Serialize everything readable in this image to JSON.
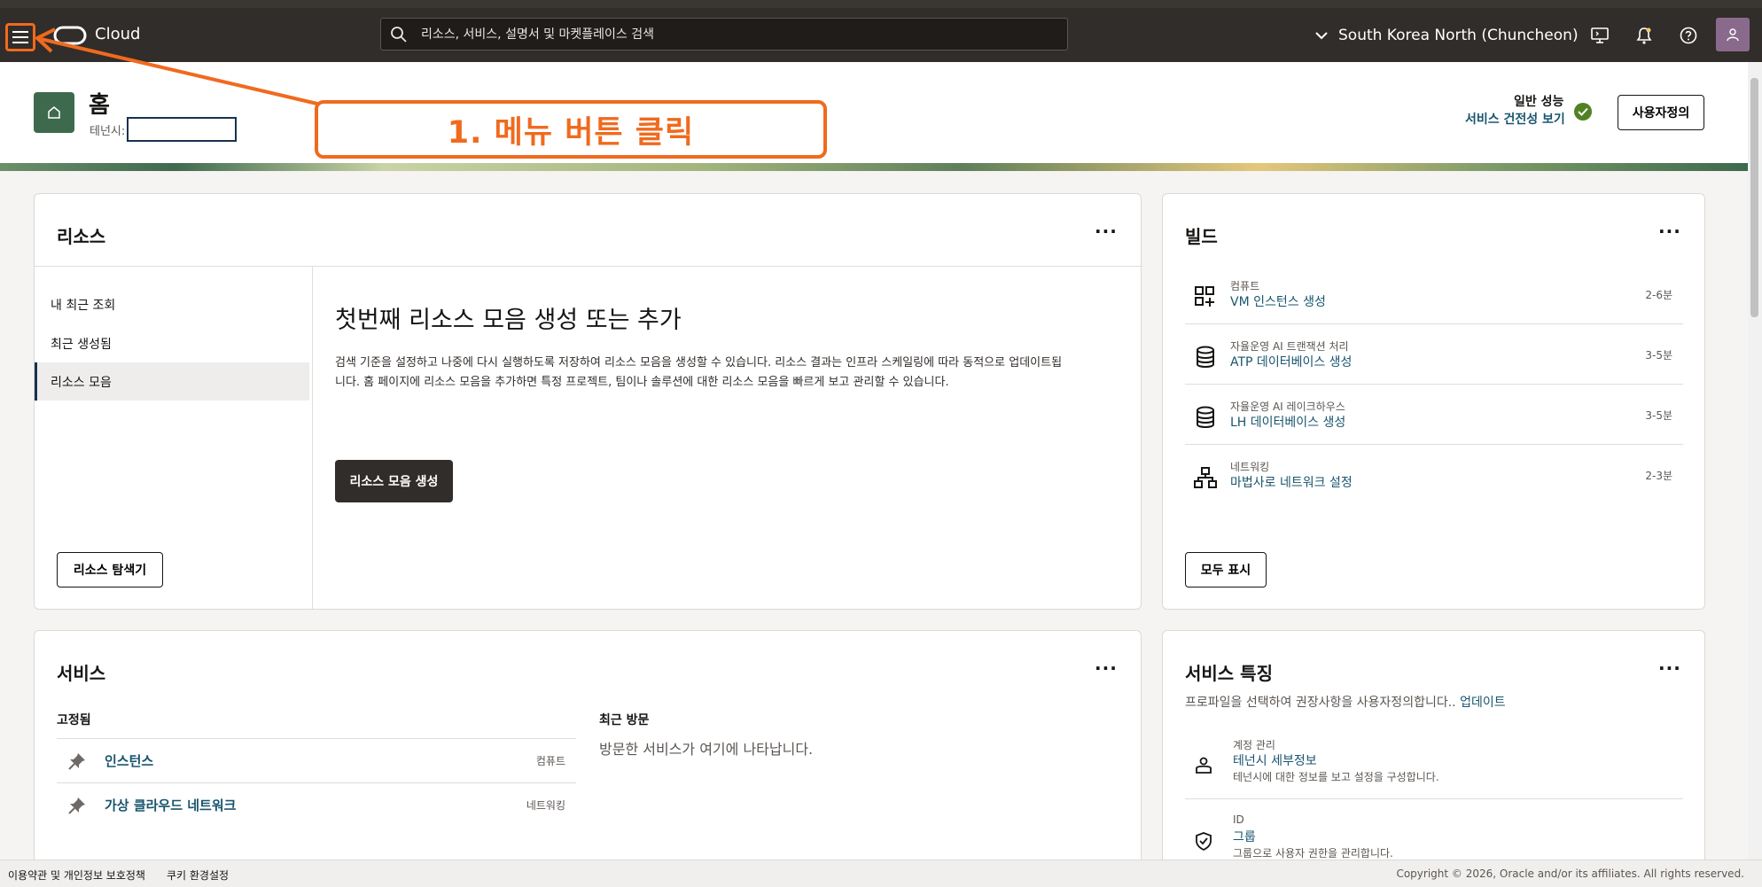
{
  "topbar": {
    "brand": "Cloud",
    "search_placeholder": "리소스, 서비스, 설명서 및 마켓플레이스 검색",
    "region": "South Korea North (Chuncheon)"
  },
  "annotation": {
    "callout": "1. 메뉴 버튼 클릭",
    "color": "#f06a1e"
  },
  "header": {
    "title": "홈",
    "tenancy_label": "테넌시:",
    "perf_label": "일반 성능",
    "health_link": "서비스 건전성 보기",
    "customize_label": "사용자정의"
  },
  "resources": {
    "title": "리소스",
    "more": "···",
    "nav": [
      "내 최근 조회",
      "최근 생성됨",
      "리소스 모음"
    ],
    "explorer_button": "리소스 탐색기",
    "heading": "첫번째 리소스 모음 생성 또는 추가",
    "description": "검색 기준을 설정하고 나중에 다시 실행하도록 저장하여 리소스 모음을 생성할 수 있습니다. 리소스 결과는 인프라 스케일링에 따라 동적으로 업데이트됩니다. 홈 페이지에 리소스 모음을 추가하면 특정 프로젝트, 팀이나 솔루션에 대한 리소스 모음을 빠르게 보고 관리할 수 있습니다.",
    "create_button": "리소스 모음 생성"
  },
  "build": {
    "title": "빌드",
    "more": "···",
    "items": [
      {
        "category": "컴퓨트",
        "link": "VM 인스턴스 생성",
        "time": "2-6분",
        "icon": "compute-icon"
      },
      {
        "category": "자율운영 AI 트랜잭션 처리",
        "link": "ATP 데이터베이스 생성",
        "time": "3-5분",
        "icon": "database-icon"
      },
      {
        "category": "자율운영 AI 레이크하우스",
        "link": "LH 데이터베이스 생성",
        "time": "3-5분",
        "icon": "database-icon"
      },
      {
        "category": "네트워킹",
        "link": "마법사로 네트워크 설정",
        "time": "2-3분",
        "icon": "network-icon"
      }
    ],
    "show_all": "모두 표시"
  },
  "services": {
    "title": "서비스",
    "more": "···",
    "pinned_label": "고정됨",
    "recent_label": "최근 방문",
    "recent_empty": "방문한 서비스가 여기에 나타납니다.",
    "pinned": [
      {
        "name": "인스턴스",
        "category": "컴퓨트"
      },
      {
        "name": "가상 클라우드 네트워크",
        "category": "네트워킹"
      }
    ]
  },
  "features": {
    "title": "서비스 특징",
    "more": "···",
    "intro": "프로파일을 선택하여 권장사항을 사용자정의합니다..",
    "intro_link": "업데이트",
    "items": [
      {
        "category": "계정 관리",
        "link": "테넌시 세부정보",
        "desc": "테넌시에 대한 정보를 보고 설정을 구성합니다.",
        "icon": "account-icon"
      },
      {
        "category": "ID",
        "link": "그룹",
        "desc": "그룹으로 사용자 권한을 관리합니다.",
        "icon": "shield-icon"
      }
    ]
  },
  "footer": {
    "terms": "이용약관 및 개인정보 보호정책",
    "cookies": "쿠키 환경설정",
    "copyright": "Copyright © 2026, Oracle and/or its affiliates. All rights reserved."
  }
}
